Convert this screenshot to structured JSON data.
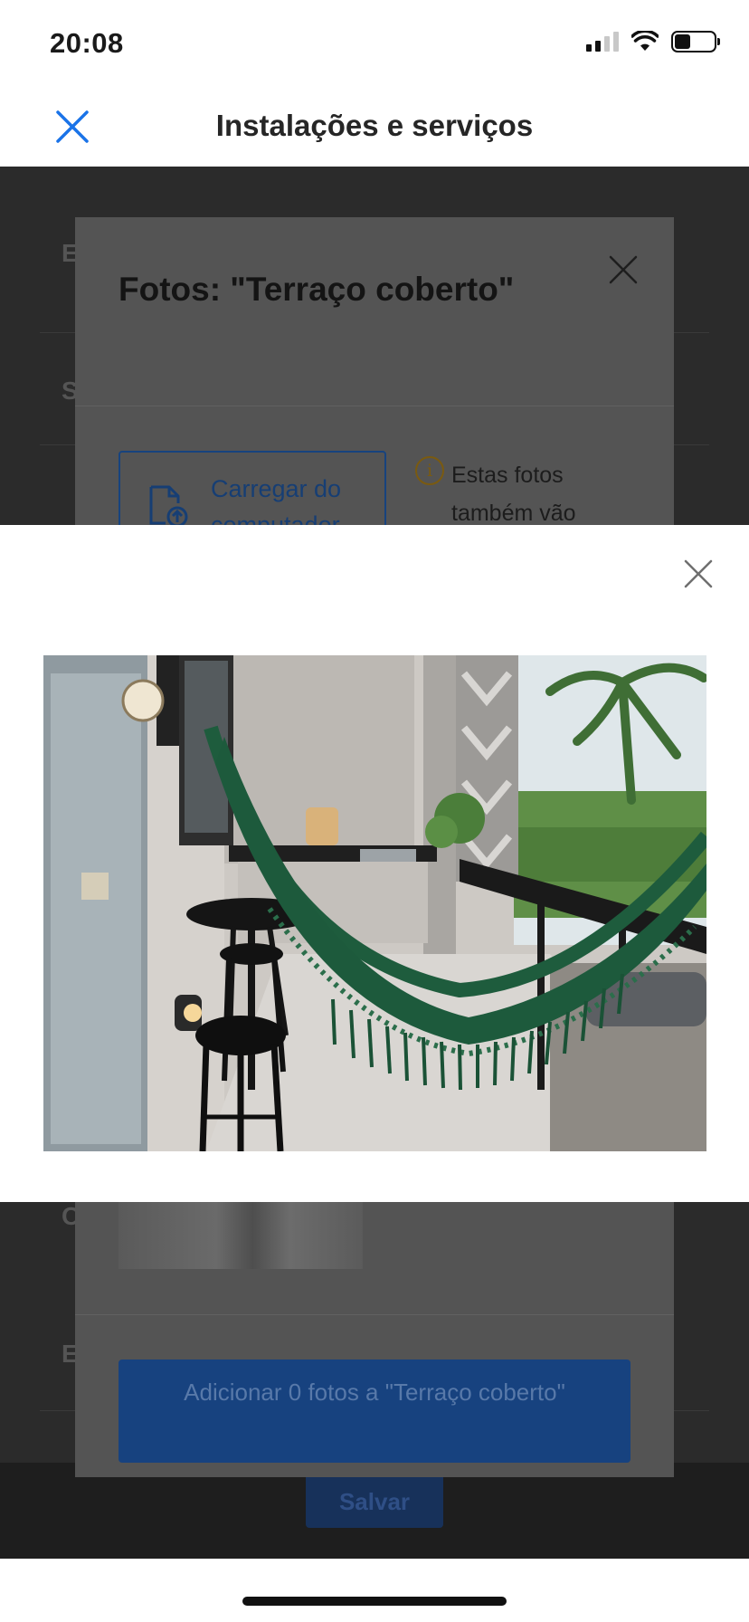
{
  "status_bar": {
    "time": "20:08",
    "icons": [
      "cellular-signal-icon",
      "wifi-icon",
      "battery-icon"
    ]
  },
  "header": {
    "title": "Instalações e serviços",
    "close_icon": "close-icon"
  },
  "background_page": {
    "row_letters": [
      "E",
      "S",
      "C",
      "E"
    ],
    "save_label": "Salvar"
  },
  "photos_dialog": {
    "title": "Fotos: \"Terraço coberto\"",
    "upload_label": "Carregar do computador",
    "info_text": "Estas fotos também vão",
    "add_button_label": "Adicionar 0 fotos a \"Terraço coberto\""
  },
  "photo_viewer": {
    "close_icon": "close-icon",
    "photo_subject": "covered terrace with green hammock"
  },
  "colors": {
    "accent": "#1a73e8",
    "overlay": "#2b2b2b",
    "hammock_green": "#1d5a3c"
  }
}
